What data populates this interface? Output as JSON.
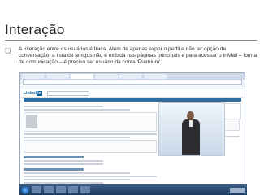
{
  "slide": {
    "title": "Interação",
    "bullet_text": "A interação entre os usuários é fraca. Além de apenas expor o perfil e não ter opção de conversação, a lista de amigos não é exibida nas páginas principais e para acessar o InMail – forma de comunicação – é preciso ser usuário da conta 'Premium'."
  },
  "screenshot": {
    "site_logo": "Linked",
    "site_logo_suffix": "in"
  },
  "icons": {
    "bullet": "square-bullet-icon",
    "start": "windows-start-icon"
  }
}
